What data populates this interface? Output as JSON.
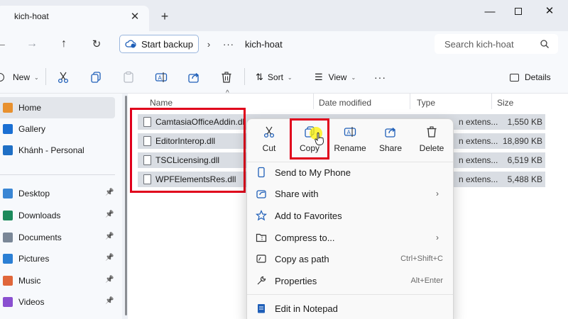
{
  "window": {
    "tab_title": "kich-hoat",
    "tab_close": "✕",
    "new_tab": "+"
  },
  "address": {
    "backup_label": "Start backup",
    "separator": "›",
    "more": "···",
    "folder": "kich-hoat",
    "search_placeholder": "Search kich-hoat"
  },
  "toolbar": {
    "new_label": "New",
    "sort_label": "Sort",
    "view_label": "View",
    "more": "···",
    "details_label": "Details"
  },
  "sidebar": {
    "items": [
      {
        "label": "Home",
        "icon": "home-icon",
        "color": "#e8912f",
        "pinned": false,
        "selected": true
      },
      {
        "label": "Gallery",
        "icon": "gallery-icon",
        "color": "#1a6fd3",
        "pinned": false
      },
      {
        "label": "Khánh - Personal",
        "icon": "onedrive-icon",
        "color": "#1f6fc5",
        "pinned": false
      },
      {
        "label": "Desktop",
        "icon": "desktop-icon",
        "color": "#3a86d4",
        "pinned": true
      },
      {
        "label": "Downloads",
        "icon": "download-icon",
        "color": "#1c8a5c",
        "pinned": true
      },
      {
        "label": "Documents",
        "icon": "documents-icon",
        "color": "#7a8797",
        "pinned": true
      },
      {
        "label": "Pictures",
        "icon": "pictures-icon",
        "color": "#2b7fd4",
        "pinned": true
      },
      {
        "label": "Music",
        "icon": "music-icon",
        "color": "#e0663a",
        "pinned": true
      },
      {
        "label": "Videos",
        "icon": "videos-icon",
        "color": "#8a4fd0",
        "pinned": true
      }
    ]
  },
  "file_list": {
    "columns": [
      "Name",
      "Date modified",
      "Type",
      "Size"
    ],
    "files": [
      {
        "name": "CamtasiaOfficeAddin.dll",
        "type": "n extens...",
        "size": "1,550 KB"
      },
      {
        "name": "EditorInterop.dll",
        "type": "n extens...",
        "size": "18,890 KB"
      },
      {
        "name": "TSCLicensing.dll",
        "type": "n extens...",
        "size": "6,519 KB"
      },
      {
        "name": "WPFElementsRes.dll",
        "type": "n extens...",
        "size": "5,488 KB"
      }
    ]
  },
  "context_menu": {
    "actions": [
      {
        "label": "Cut",
        "icon": "scissors-icon"
      },
      {
        "label": "Copy",
        "icon": "copy-icon"
      },
      {
        "label": "Rename",
        "icon": "rename-icon"
      },
      {
        "label": "Share",
        "icon": "share-icon"
      },
      {
        "label": "Delete",
        "icon": "trash-icon"
      }
    ],
    "items": [
      {
        "label": "Send to My Phone",
        "icon": "phone-icon",
        "shortcut": "",
        "submenu": false
      },
      {
        "label": "Share with",
        "icon": "share-with-icon",
        "shortcut": "",
        "submenu": true
      },
      {
        "label": "Add to Favorites",
        "icon": "star-icon",
        "shortcut": "",
        "submenu": false
      },
      {
        "label": "Compress to...",
        "icon": "zip-folder-icon",
        "shortcut": "",
        "submenu": true
      },
      {
        "label": "Copy as path",
        "icon": "copy-path-icon",
        "shortcut": "Ctrl+Shift+C",
        "submenu": false
      },
      {
        "label": "Properties",
        "icon": "properties-icon",
        "shortcut": "Alt+Enter",
        "submenu": false
      },
      {
        "label": "Edit in Notepad",
        "icon": "notepad-icon",
        "shortcut": "",
        "submenu": false
      }
    ],
    "submenu_arrow": "›"
  },
  "colors": {
    "annotation": "#e0001b",
    "accent": "#0067c0",
    "cursor_highlight": "#fff000"
  }
}
